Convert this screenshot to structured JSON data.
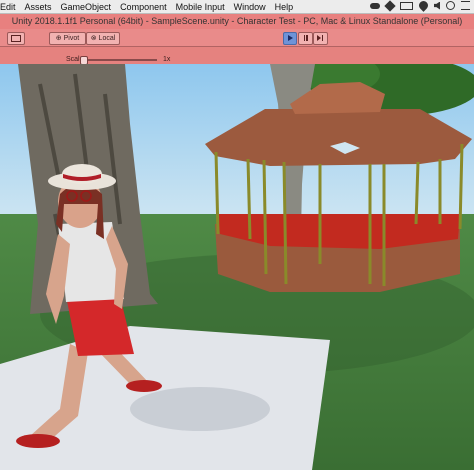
{
  "menubar": {
    "items": [
      "Edit",
      "Assets",
      "GameObject",
      "Component",
      "Mobile Input",
      "Window",
      "Help"
    ]
  },
  "window": {
    "title": "Unity 2018.1.1f1 Personal (64bit) - SampleScene.unity - Character Test - PC, Mac & Linux Standalone (Personal)"
  },
  "toolbar": {
    "pivot_label": "Pivot",
    "local_label": "Local"
  },
  "game_view": {
    "scale_label": "Scale",
    "scale_value": "1x"
  },
  "colors": {
    "play_mode_tint": "#e8807f",
    "play_button": "#6f93d8"
  },
  "icons": [
    "rect-tool-icon",
    "pivot-icon",
    "local-icon",
    "play-icon",
    "pause-icon",
    "step-icon",
    "cloud-icon",
    "dropbox-icon",
    "battery-icon",
    "wifi-icon",
    "sound-icon",
    "spotlight-icon",
    "menu-icon"
  ]
}
